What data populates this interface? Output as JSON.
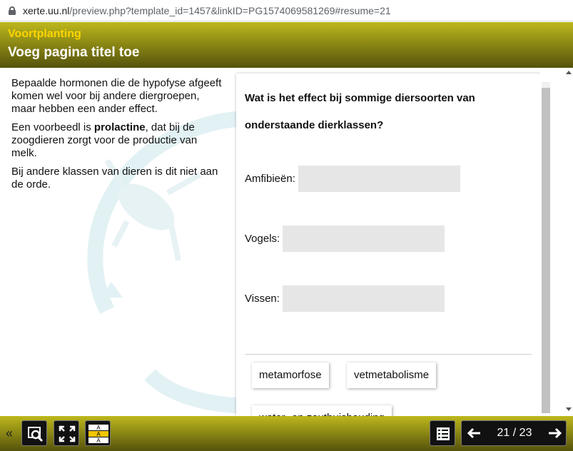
{
  "browser": {
    "host": "xerte.uu.nl",
    "path": "/preview.php?template_id=1457&linkID=PG1574069581269#resume=21"
  },
  "header": {
    "module": "Voortplanting",
    "title": "Voeg pagina titel toe"
  },
  "content": {
    "p1": "Bepaalde hormonen die de hypofyse afgeeft komen wel voor bij andere diergroepen, maar hebben een ander effect.",
    "p2_pre": "Een voorbeedl is ",
    "p2_bold": "prolactine",
    "p2_post": ", dat bij de zoogdieren zorgt voor de productie van melk.",
    "p3": "Bij andere klassen van dieren is dit niet aan de orde."
  },
  "quiz": {
    "question": "Wat is het effect bij sommige diersoorten van onderstaande dierklassen?",
    "targets": [
      {
        "label": "Amfibieën:"
      },
      {
        "label": "Vogels:"
      },
      {
        "label": "Vissen:"
      }
    ],
    "options": [
      "metamorfose",
      "vetmetabolisme",
      "water- en zouthuishouding"
    ]
  },
  "footer": {
    "collapse_label": "«",
    "page_current": "21",
    "page_total": "23",
    "page_text": "21 / 23"
  },
  "colors": {
    "header_top": "#bdb81c",
    "header_bottom": "#55520c",
    "module_title": "#ffd400",
    "drop_zone": "#e6e6e6"
  },
  "icons": {
    "footer": [
      "zoom-icon",
      "fullscreen-icon",
      "text-size-icon",
      "table-of-contents-icon",
      "arrow-left-icon",
      "arrow-right-icon"
    ],
    "browser": [
      "lock-icon"
    ]
  }
}
